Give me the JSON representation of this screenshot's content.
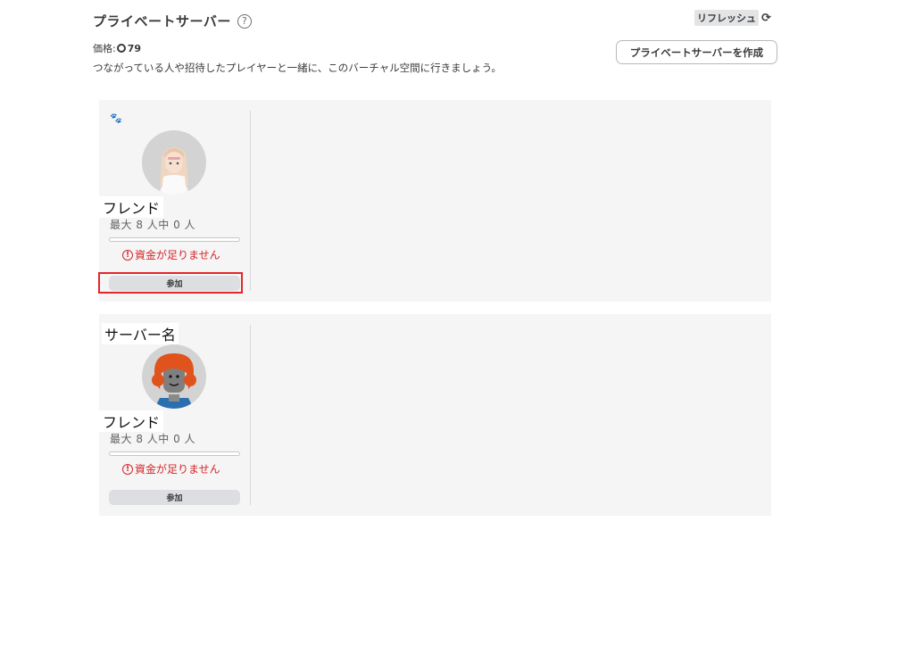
{
  "header": {
    "title": "プライベートサーバー",
    "help_icon": "?",
    "refresh_label": "リフレッシュ",
    "refresh_icon": "refresh-icon"
  },
  "price": {
    "label": "価格:",
    "value": "79",
    "currency_icon": "robux-icon"
  },
  "description": "つながっている人や招待したプレイヤーと一緒に、このバーチャル空間に行きましょう。",
  "create_button_label": "プライベートサーバーを作成",
  "servers": [
    {
      "name": "",
      "badge_icon": "paw-icon",
      "friend_label": "フレンド",
      "capacity": "最大 8 人中 0 人",
      "fill_fraction": 0,
      "error": "資金が足りません",
      "join_label": "参加"
    },
    {
      "name": "サーバー名",
      "friend_label": "フレンド",
      "capacity": "最大 8 人中 0 人",
      "fill_fraction": 0,
      "error": "資金が足りません",
      "join_label": "参加"
    }
  ],
  "colors": {
    "error": "#d6262b",
    "card_bg": "#f5f5f5",
    "highlight": "#e3262b"
  }
}
